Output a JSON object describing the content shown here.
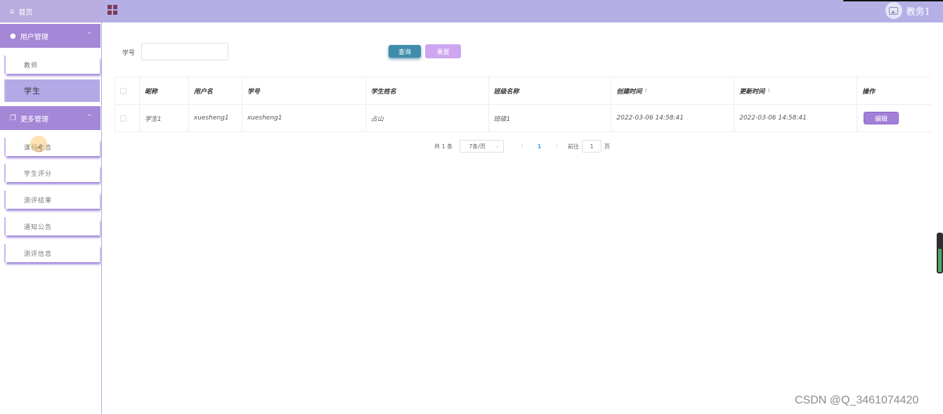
{
  "sidebar": {
    "home": {
      "label": "首页",
      "icon": "home-icon"
    },
    "groups": [
      {
        "label": "用户管理",
        "icon": "user-icon",
        "items": [
          {
            "label": "教师"
          },
          {
            "label": "学生",
            "active": true
          }
        ]
      },
      {
        "label": "更多管理",
        "icon": "copy-icon",
        "items": [
          {
            "label": "课程信息"
          },
          {
            "label": "学生评分"
          },
          {
            "label": "测评结果"
          },
          {
            "label": "通知公告"
          },
          {
            "label": "测评信息"
          }
        ]
      }
    ]
  },
  "header": {
    "menu_icon": "grid-menu-icon",
    "user_name": "教务1",
    "avatar_icon": "image-icon"
  },
  "search": {
    "label": "学号",
    "value": "",
    "placeholder": "",
    "query_button": "查询",
    "reset_button": "重置"
  },
  "table": {
    "columns": [
      "昵称",
      "用户名",
      "学号",
      "学生姓名",
      "班级名称",
      "创建时间",
      "更新时间",
      "操作"
    ],
    "rows": [
      {
        "nickname": "学生1",
        "username": "xuesheng1",
        "student_no": "xuesheng1",
        "student_name": "占山",
        "class_name": "班级1",
        "created": "2022-03-06 14:58:41",
        "updated": "2022-03-06 14:58:41",
        "action": "编辑"
      }
    ]
  },
  "pagination": {
    "total_text": "共 1 条",
    "page_size": "7条/页",
    "current_page": "1",
    "goto_label": "前往",
    "goto_value": "1",
    "page_unit": "页"
  },
  "scroll_indicator_level": 0.62,
  "watermark": "CSDN @Q_3461074420",
  "colors": {
    "sidebar_header": "#a487d6",
    "topbar": "#b4b0e6",
    "active_item": "#b3a9e6",
    "query_button": "#3f8cab",
    "reset_button": "#cda6f0",
    "edit_button": "#a47fd8"
  }
}
